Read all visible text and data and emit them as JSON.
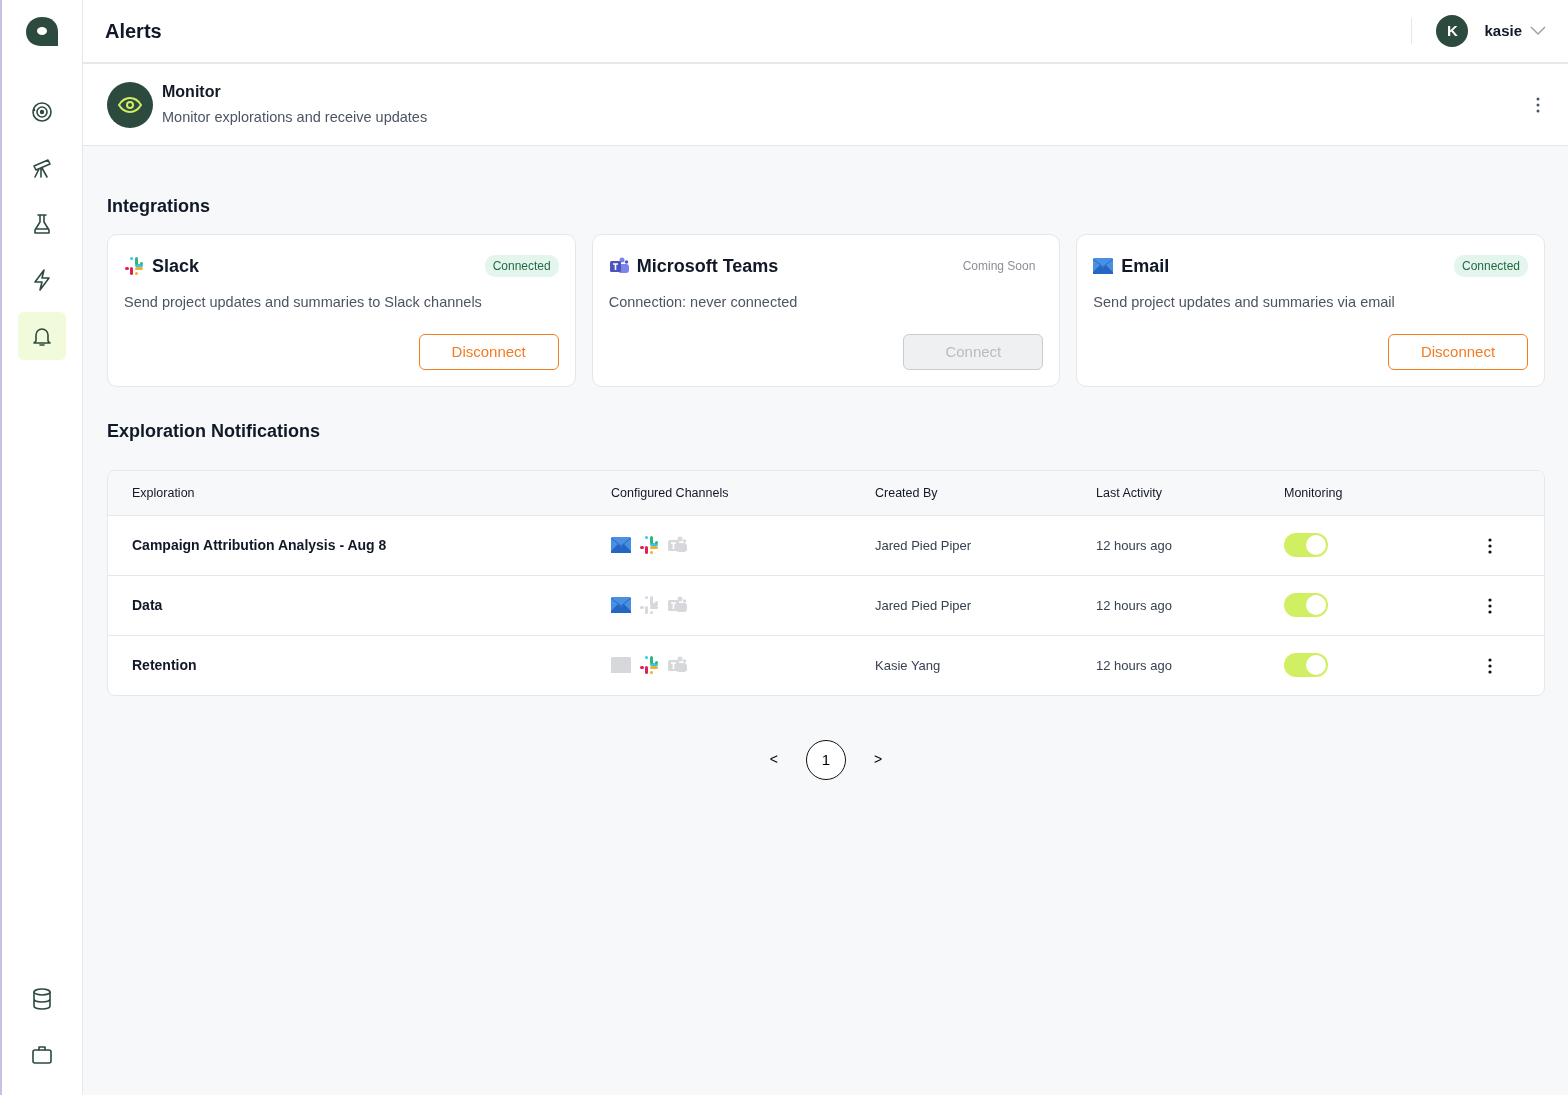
{
  "sidebar": {
    "items": [
      {
        "selected": false
      },
      {
        "selected": false
      },
      {
        "selected": false
      },
      {
        "selected": false
      },
      {
        "selected": true
      }
    ],
    "bottom_items": [
      {
        "selected": false
      },
      {
        "selected": false
      }
    ]
  },
  "header": {
    "title": "Alerts",
    "user": {
      "initial": "K",
      "name": "kasie"
    }
  },
  "monitor": {
    "title": "Monitor",
    "subtitle": "Monitor explorations and receive updates"
  },
  "integrations": {
    "title": "Integrations",
    "cards": [
      {
        "kind": "slack",
        "name": "Slack",
        "status": {
          "label": "Connected",
          "kind": "connected"
        },
        "description": "Send project updates and summaries to Slack channels",
        "button": "Disconnect",
        "disabled": false
      },
      {
        "kind": "teams",
        "name": "Microsoft Teams",
        "status": {
          "label": "Coming Soon",
          "kind": "pending"
        },
        "description": "Connection: never connected",
        "button": "Connect",
        "disabled": true
      },
      {
        "kind": "email",
        "name": "Email",
        "status": {
          "label": "Connected",
          "kind": "connected"
        },
        "description": "Send project updates and summaries via email",
        "button": "Disconnect",
        "disabled": false
      }
    ]
  },
  "notifications": {
    "title": "Exploration Notifications",
    "columns": [
      "Exploration",
      "Configured Channels",
      "Created By",
      "Last Activity",
      "Monitoring"
    ],
    "rows": [
      {
        "exploration": "Campaign Attribution Analysis - Aug 8",
        "channels": [
          {
            "kind": "email",
            "active": true
          },
          {
            "kind": "slack",
            "active": true
          },
          {
            "kind": "teams",
            "active": false
          }
        ],
        "created_by": "Jared Pied Piper",
        "last_activity": "12 hours ago",
        "on": true
      },
      {
        "exploration": "Data",
        "channels": [
          {
            "kind": "email",
            "active": true
          },
          {
            "kind": "slack",
            "active": false
          },
          {
            "kind": "teams",
            "active": false
          }
        ],
        "created_by": "Jared Pied Piper",
        "last_activity": "12 hours ago",
        "on": true
      },
      {
        "exploration": "Retention",
        "channels": [
          {
            "kind": "email",
            "active": false
          },
          {
            "kind": "slack",
            "active": true
          },
          {
            "kind": "teams",
            "active": false
          }
        ],
        "created_by": "Kasie Yang",
        "last_activity": "12 hours ago",
        "on": true
      }
    ]
  },
  "pagination": {
    "prev": "<",
    "pages": [
      {
        "label": "1",
        "selected": true
      }
    ],
    "next": ">"
  }
}
